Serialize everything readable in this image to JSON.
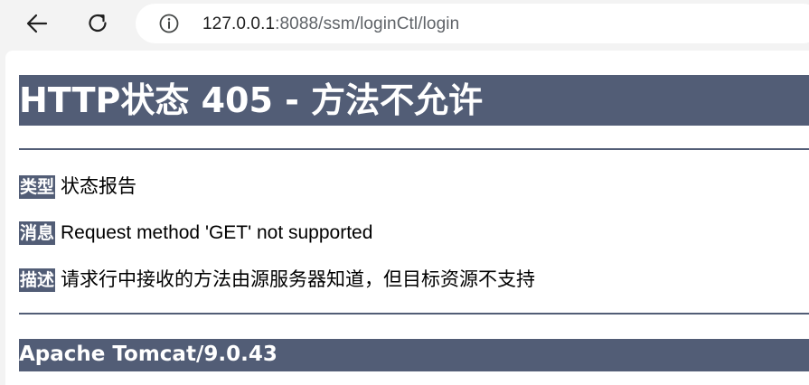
{
  "browser": {
    "back_icon": "arrow-left-icon",
    "reload_icon": "reload-icon",
    "site_info_icon": "info-icon",
    "url_host": "127.0.0.1",
    "url_rest": ":8088/ssm/loginCtl/login"
  },
  "page": {
    "title": "HTTP状态 405 - 方法不允许",
    "type_label": "类型",
    "type_value": "状态报告",
    "message_label": "消息",
    "message_value": "Request method 'GET' not supported",
    "description_label": "描述",
    "description_value": "请求行中接收的方法由源服务器知道，但目标资源不支持",
    "footer": "Apache Tomcat/9.0.43"
  },
  "colors": {
    "tomcat_header_bg": "#525d76",
    "browser_chrome_bg": "#f3f3f3",
    "address_bar_bg": "#ffffff"
  }
}
